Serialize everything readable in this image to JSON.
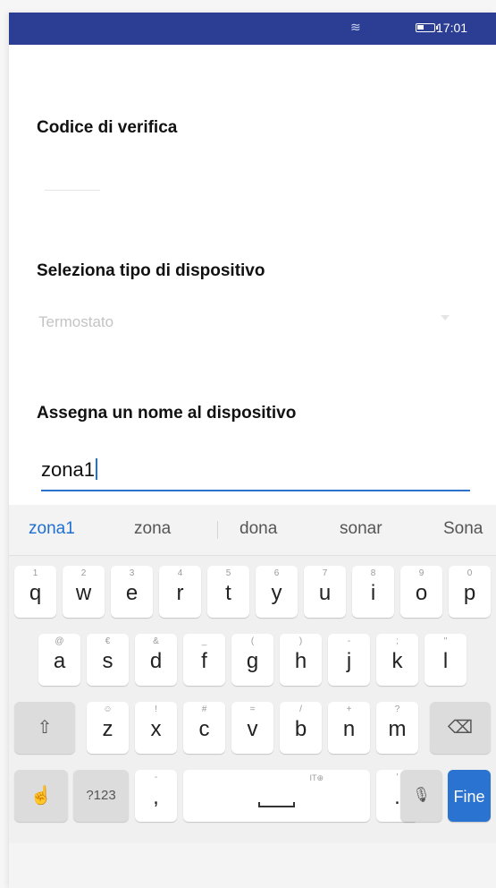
{
  "status_bar": {
    "time": "17:01",
    "wifi_icon": "wifi-icon",
    "battery_icon": "battery-icon"
  },
  "form": {
    "verification_label": "Codice di verifica",
    "device_type_label": "Seleziona tipo di dispositivo",
    "device_type_value": "Termostato",
    "device_name_label": "Assegna un nome al dispositivo",
    "device_name_value": "zona1"
  },
  "keyboard": {
    "suggestions": [
      "zona1",
      "zona",
      "dona",
      "sonar",
      "Sona"
    ],
    "row1": [
      {
        "hint": "1",
        "ch": "q"
      },
      {
        "hint": "2",
        "ch": "w"
      },
      {
        "hint": "3",
        "ch": "e"
      },
      {
        "hint": "4",
        "ch": "r"
      },
      {
        "hint": "5",
        "ch": "t"
      },
      {
        "hint": "6",
        "ch": "y"
      },
      {
        "hint": "7",
        "ch": "u"
      },
      {
        "hint": "8",
        "ch": "i"
      },
      {
        "hint": "9",
        "ch": "o"
      },
      {
        "hint": "0",
        "ch": "p"
      }
    ],
    "row2": [
      {
        "hint": "@",
        "ch": "a"
      },
      {
        "hint": "€",
        "ch": "s"
      },
      {
        "hint": "&",
        "ch": "d"
      },
      {
        "hint": "_",
        "ch": "f"
      },
      {
        "hint": "(",
        "ch": "g"
      },
      {
        "hint": ")",
        "ch": "h"
      },
      {
        "hint": "-",
        "ch": "j"
      },
      {
        "hint": ";",
        "ch": "k"
      },
      {
        "hint": "\"",
        "ch": "l"
      }
    ],
    "row3": [
      {
        "hint": "☺",
        "ch": "z"
      },
      {
        "hint": "!",
        "ch": "x"
      },
      {
        "hint": "#",
        "ch": "c"
      },
      {
        "hint": "=",
        "ch": "v"
      },
      {
        "hint": "/",
        "ch": "b"
      },
      {
        "hint": "+",
        "ch": "n"
      },
      {
        "hint": "?",
        "ch": "m"
      }
    ],
    "shift_glyph": "⇧",
    "backspace_glyph": "⌫",
    "gesture_glyph": "☝",
    "symbols_label": "?123",
    "comma_label": ",",
    "comma_hint": "-",
    "space_hint": "IT⊕",
    "period_label": ".",
    "period_hint": "'",
    "mic_glyph": "🎙",
    "enter_label": "Fine"
  }
}
